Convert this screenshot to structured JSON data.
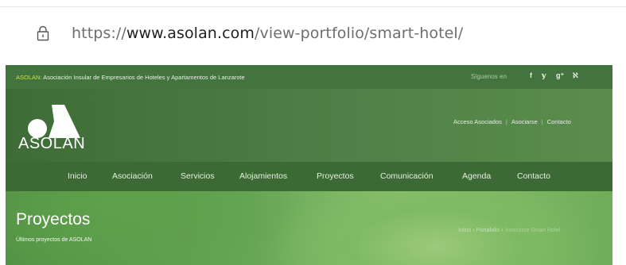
{
  "browser": {
    "url_scheme": "https://",
    "url_host": "www.asolan.com",
    "url_path": "/view-portfolio/smart-hotel/"
  },
  "topbar": {
    "brand": "ASOLAN:",
    "association": " Asociación Insular de Empresarios de Hoteles y Apartamentos de Lanzarote",
    "follow_label": "Síguenos en",
    "social": [
      "f",
      "𝕪",
      "g⁺",
      "ℵ"
    ]
  },
  "header": {
    "logo_text": "ASOLAN",
    "links": [
      "Acceso Asociados",
      "Asociarse",
      "Contacto"
    ]
  },
  "nav": {
    "items": [
      "Inicio",
      "Asociación",
      "Servicios",
      "Alojamientos",
      "Proyectos",
      "Comunicación",
      "Agenda",
      "Contacto"
    ]
  },
  "banner": {
    "title": "Proyectos",
    "subtitle": "Últimos proyectos de ASOLAN",
    "breadcrumb": [
      "Inicio",
      "Portafolio",
      "Asociarse Smart Hotel"
    ]
  },
  "colors": {
    "brand_green": "#c6e23c",
    "nav_bg": "#3c6a34"
  }
}
